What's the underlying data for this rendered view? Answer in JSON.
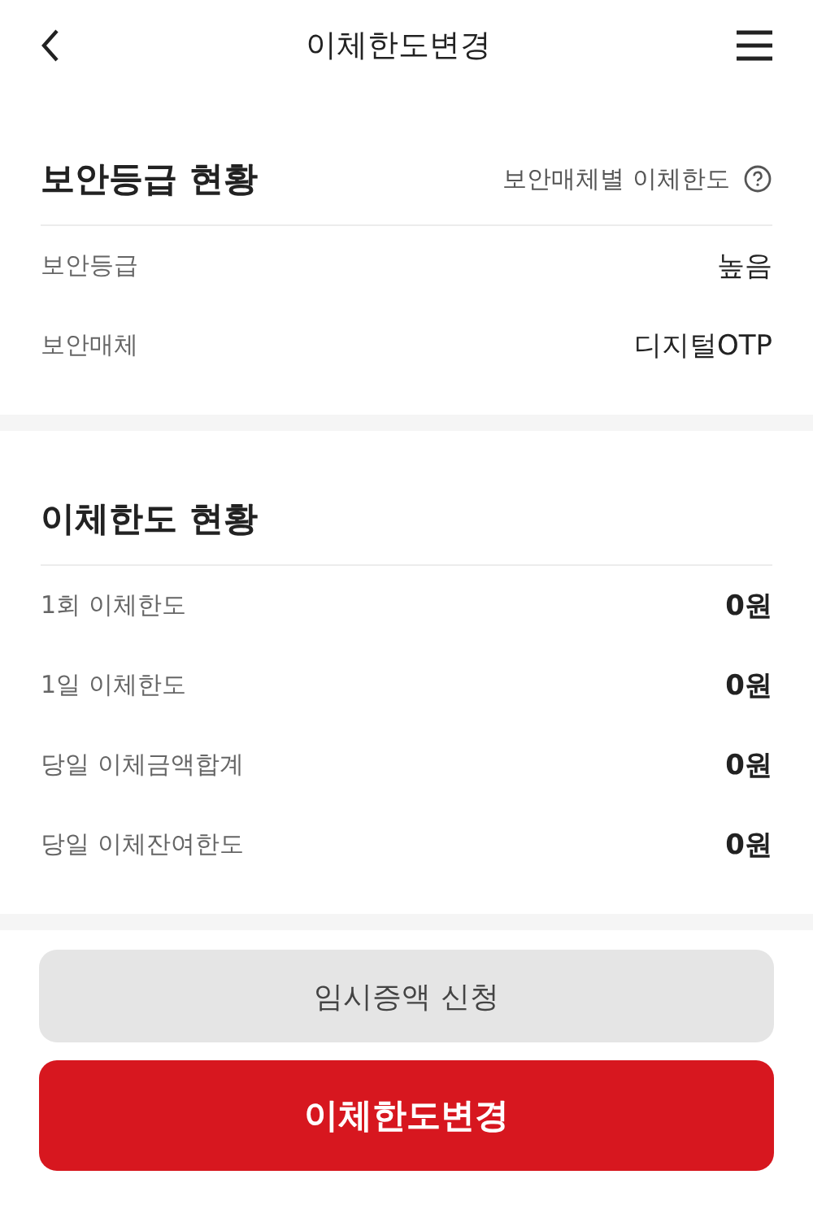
{
  "header": {
    "title": "이체한도변경"
  },
  "sections": [
    {
      "title": "보안등급 현황",
      "link": "보안매체별 이체한도",
      "rows": [
        {
          "label": "보안등급",
          "value": "높음"
        },
        {
          "label": "보안매체",
          "value": "디지털OTP"
        }
      ]
    },
    {
      "title": "이체한도 현황",
      "rows": [
        {
          "label": "1회 이체한도",
          "value": "0원"
        },
        {
          "label": "1일 이체한도",
          "value": "0원"
        },
        {
          "label": "당일 이체금액합계",
          "value": "0원"
        },
        {
          "label": "당일 이체잔여한도",
          "value": "0원"
        }
      ]
    }
  ],
  "buttons": [
    {
      "label": "임시증액 신청",
      "kind": "secondary"
    },
    {
      "label": "이체한도변경",
      "kind": "primary"
    }
  ]
}
